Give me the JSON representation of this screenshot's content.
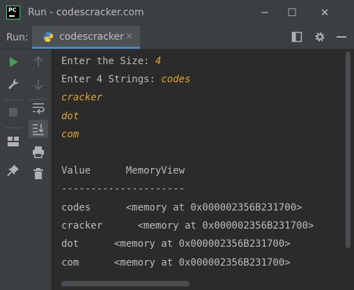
{
  "window": {
    "title": "Run - codescracker.com",
    "logo_text": "PC"
  },
  "toolbar": {
    "run_label": "Run:",
    "tab_label": "codescracker",
    "tab_close": "×"
  },
  "controls": {
    "minimize": "─",
    "maximize": "☐",
    "close": "✕"
  },
  "console": {
    "lines": [
      {
        "prompt": "Enter the Size: ",
        "input": "4"
      },
      {
        "prompt": "Enter 4 Strings: ",
        "input": "codes"
      },
      {
        "prompt": "",
        "input": "cracker"
      },
      {
        "prompt": "",
        "input": "dot"
      },
      {
        "prompt": "",
        "input": "com"
      }
    ],
    "header": "Value      MemoryView",
    "divider": "---------------------",
    "rows": [
      "codes      <memory at 0x000002356B231700>",
      "cracker      <memory at 0x000002356B231700>",
      "dot      <memory at 0x000002356B231700>",
      "com      <memory at 0x000002356B231700>"
    ]
  },
  "colors": {
    "input": "#e0a62c",
    "text": "#bbbbbb",
    "background": "#2b2b2b",
    "tab_underline": "#4a88c7",
    "run_green": "#499c54"
  }
}
